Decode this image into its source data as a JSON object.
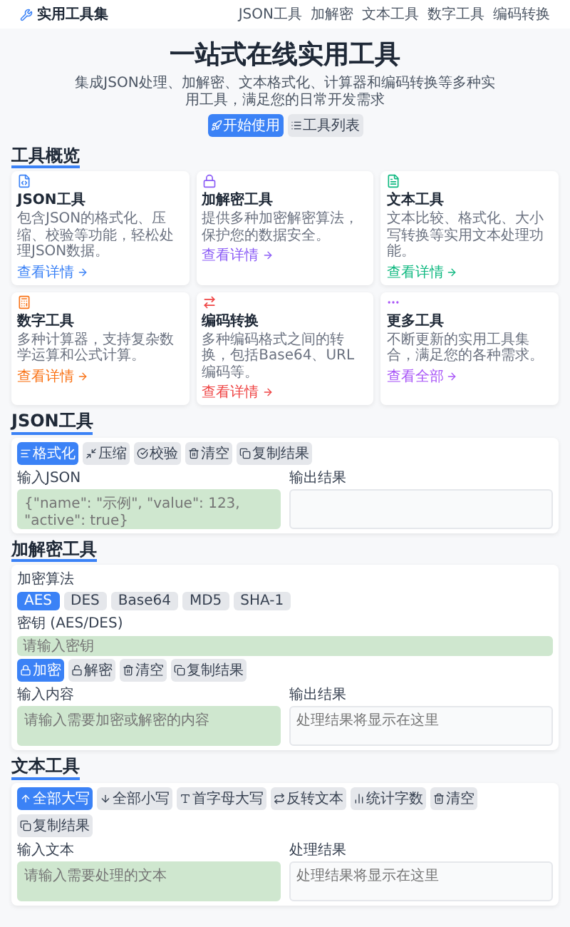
{
  "header": {
    "logo": "实用工具集",
    "nav": [
      "JSON工具",
      "加解密",
      "文本工具",
      "数字工具",
      "编码转换"
    ]
  },
  "hero": {
    "title": "一站式在线实用工具",
    "subtitle": "集成JSON处理、加解密、文本格式化、计算器和编码转换等多种实用工具，满足您的日常开发需求",
    "buttons": [
      {
        "label": "开始使用",
        "primary": true
      },
      {
        "label": "工具列表",
        "primary": false
      }
    ]
  },
  "overview": {
    "title": "工具概览",
    "cards": [
      {
        "title": "JSON工具",
        "desc": "包含JSON的格式化、压缩、校验等功能，轻松处理JSON数据。",
        "link": "查看详情",
        "color": "#3b82f6"
      },
      {
        "title": "加解密工具",
        "desc": "提供多种加密解密算法，保护您的数据安全。",
        "link": "查看详情",
        "color": "#8b5cf6"
      },
      {
        "title": "文本工具",
        "desc": "文本比较、格式化、大小写转换等实用文本处理功能。",
        "link": "查看详情",
        "color": "#10b981"
      },
      {
        "title": "数字工具",
        "desc": "多种计算器，支持复杂数学运算和公式计算。",
        "link": "查看详情",
        "color": "#f97316"
      },
      {
        "title": "编码转换",
        "desc": "多种编码格式之间的转换，包括Base64、URL编码等。",
        "link": "查看详情",
        "color": "#ef4444"
      },
      {
        "title": "更多工具",
        "desc": "不断更新的实用工具集合，满足您的各种需求。",
        "link": "查看全部",
        "color": "#a855f7"
      }
    ]
  },
  "json_tool": {
    "title": "JSON工具",
    "buttons": [
      {
        "label": "格式化",
        "primary": true
      },
      {
        "label": "压缩",
        "primary": false
      },
      {
        "label": "校验",
        "primary": false
      },
      {
        "label": "清空",
        "primary": false
      },
      {
        "label": "复制结果",
        "primary": false
      }
    ],
    "input_label": "输入JSON",
    "input_placeholder": "{\"name\": \"示例\", \"value\": 123, \"active\": true}",
    "output_label": "输出结果"
  },
  "crypto_tool": {
    "title": "加解密工具",
    "algo_label": "加密算法",
    "algorithms": [
      {
        "label": "AES",
        "selected": true
      },
      {
        "label": "DES",
        "selected": false
      },
      {
        "label": "Base64",
        "selected": false
      },
      {
        "label": "MD5",
        "selected": false
      },
      {
        "label": "SHA-1",
        "selected": false
      }
    ],
    "key_label": "密钥 (AES/DES)",
    "key_placeholder": "请输入密钥",
    "buttons": [
      {
        "label": "加密",
        "primary": true
      },
      {
        "label": "解密",
        "primary": false
      },
      {
        "label": "清空",
        "primary": false
      },
      {
        "label": "复制结果",
        "primary": false
      }
    ],
    "input_label": "输入内容",
    "input_placeholder": "请输入需要加密或解密的内容",
    "output_label": "输出结果",
    "output_placeholder": "处理结果将显示在这里"
  },
  "text_tool": {
    "title": "文本工具",
    "buttons": [
      {
        "label": "全部大写",
        "primary": true
      },
      {
        "label": "全部小写",
        "primary": false
      },
      {
        "label": "首字母大写",
        "primary": false
      },
      {
        "label": "反转文本",
        "primary": false
      },
      {
        "label": "统计字数",
        "primary": false
      },
      {
        "label": "清空",
        "primary": false
      },
      {
        "label": "复制结果",
        "primary": false
      }
    ],
    "input_label": "输入文本",
    "input_placeholder": "请输入需要处理的文本",
    "output_label": "处理结果",
    "output_placeholder": "处理结果将显示在这里"
  }
}
